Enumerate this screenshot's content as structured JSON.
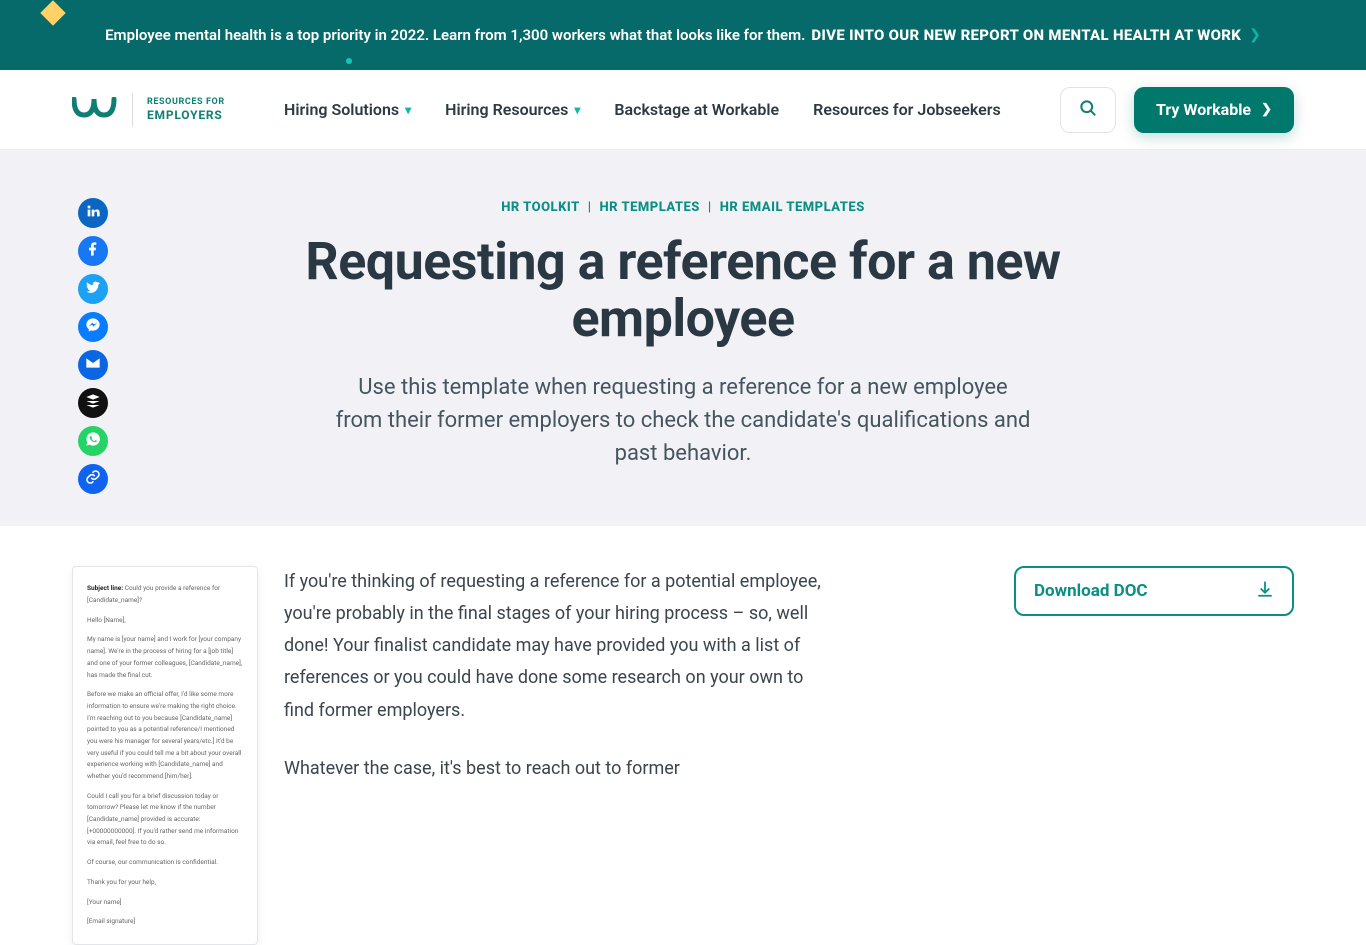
{
  "announce": {
    "text": "Employee mental health is a top priority in 2022. Learn from 1,300 workers what that looks like for them.",
    "cta": "DIVE INTO OUR NEW REPORT ON MENTAL HEALTH AT WORK"
  },
  "logo": {
    "line1": "RESOURCES FOR",
    "line2": "EMPLOYERS"
  },
  "nav": {
    "items": [
      {
        "label": "Hiring Solutions",
        "dropdown": true
      },
      {
        "label": "Hiring Resources",
        "dropdown": true
      },
      {
        "label": "Backstage at Workable",
        "dropdown": false
      },
      {
        "label": "Resources for Jobseekers",
        "dropdown": false
      }
    ],
    "cta": "Try Workable"
  },
  "breadcrumb": [
    "HR TOOLKIT",
    "HR TEMPLATES",
    "HR EMAIL TEMPLATES"
  ],
  "title": "Requesting a reference for a new employee",
  "lead": "Use this template when requesting a reference for a new employee from their former employers to check the candidate's qualifications and past behavior.",
  "share": [
    {
      "name": "linkedin",
      "color": "#0a66c2"
    },
    {
      "name": "facebook",
      "color": "#1877f2"
    },
    {
      "name": "twitter",
      "color": "#1da1f2"
    },
    {
      "name": "messenger",
      "color": "#0a7cff"
    },
    {
      "name": "email",
      "color": "#0b66e3"
    },
    {
      "name": "buffer",
      "color": "#111111"
    },
    {
      "name": "whatsapp",
      "color": "#25d366"
    },
    {
      "name": "copy-link",
      "color": "#1062f0"
    }
  ],
  "thumb": {
    "subject_label": "Subject line:",
    "subject": "Could you provide a reference for [Candidate_name]?",
    "lines": [
      "Hello [Name],",
      "My name is [your name] and I work for [your company name]. We're in the process of hiring for a [job title] and one of your former colleagues, [Candidate_name], has made the final cut.",
      "Before we make an official offer, I'd like some more information to ensure we're making the right choice. I'm reaching out to you because [Candidate_name] pointed to you as a potential reference/I mentioned you were his manager for several years/etc.] It'd be very useful if you could tell me a bit about your overall experience working with [Candidate_name] and whether you'd recommend [him/her].",
      "Could I call you for a brief discussion today or tomorrow? Please let me know if the number [Candidate_name] provided is accurate: [+00000000000]. If you'd rather send me information via email, feel free to do so.",
      "Of course, our communication is confidential.",
      "Thank you for your help,",
      "[Your name]",
      "[Email signature]"
    ]
  },
  "article": {
    "p1": "If you're thinking of requesting a reference for a potential employee, you're probably in the final stages of your hiring process – so, well done! Your finalist candidate may have provided you with a list of references or you could have done some research on your own to find former employers.",
    "p2": "Whatever the case, it's best to reach out to former"
  },
  "download": {
    "label": "Download DOC"
  },
  "colors": {
    "accent": "#0a8f84",
    "brand_dark": "#00786c",
    "announce_bg": "#066a6a"
  }
}
